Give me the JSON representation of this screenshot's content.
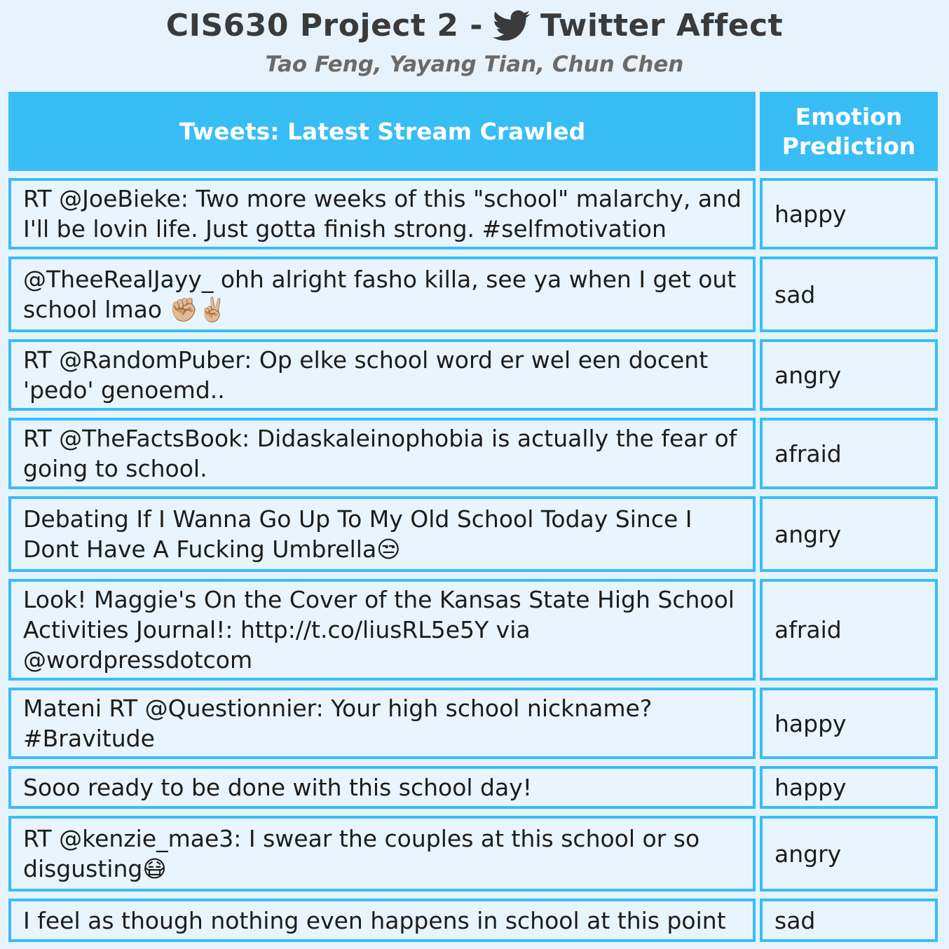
{
  "header": {
    "title_prefix": "CIS630 Project 2 -",
    "title_suffix": "Twitter Affect",
    "bird_icon": "twitter-bird-icon",
    "bird_color": "#3a3a3a",
    "authors": "Tao Feng, Yayang Tian, Chun Chen"
  },
  "table": {
    "col_tweets": "Tweets: Latest Stream Crawled",
    "col_emotion": "Emotion Prediction",
    "accent_color": "#38bdf8",
    "rows": [
      {
        "tweet": "RT @JoeBieke: Two more weeks of this \"school\" malarchy, and I'll be lovin life. Just gotta finish strong. #selfmotivation",
        "emotion": "happy"
      },
      {
        "tweet": "@TheeRealJayy_ ohh alright fasho killa, see ya when I get out school lmao ✊🏼✌🏼",
        "emotion": "sad"
      },
      {
        "tweet": "RT @RandomPuber: Op elke school word er wel een docent 'pedo' genoemd..",
        "emotion": "angry"
      },
      {
        "tweet": "RT @TheFactsBook: Didaskaleinophobia is actually the fear of going to school.",
        "emotion": "afraid"
      },
      {
        "tweet": "Debating If I Wanna Go Up To My Old School Today Since I Dont Have A Fucking Umbrella😒",
        "emotion": "angry"
      },
      {
        "tweet": "Look! Maggie's On the Cover of the Kansas State High School Activities Journal!: http://t.co/liusRL5e5Y via @wordpressdotcom",
        "emotion": "afraid"
      },
      {
        "tweet": "Mateni RT @Questionnier: Your high school nickname? #Bravitude",
        "emotion": "happy"
      },
      {
        "tweet": "Sooo ready to be done with this school day!",
        "emotion": "happy"
      },
      {
        "tweet": "RT @kenzie_mae3: I swear the couples at this school or so disgusting😷",
        "emotion": "angry"
      },
      {
        "tweet": "I feel as though nothing even happens in school at this point",
        "emotion": "sad"
      }
    ]
  }
}
